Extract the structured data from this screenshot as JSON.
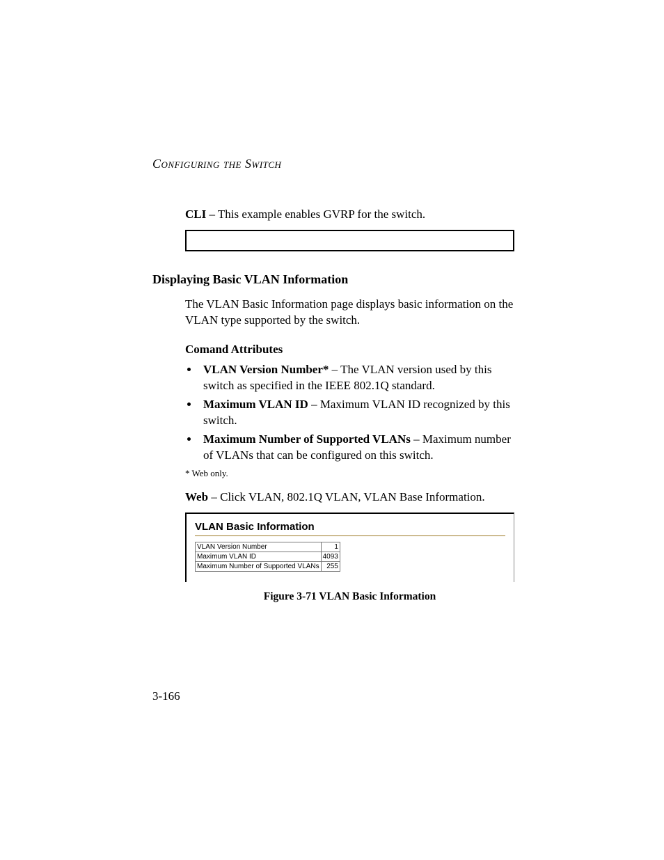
{
  "header": {
    "running_head": "Configuring the Switch"
  },
  "cli": {
    "label": "CLI",
    "text": " – This example enables GVRP for the switch."
  },
  "section": {
    "title": "Displaying Basic VLAN Information",
    "intro": "The VLAN Basic Information page displays basic information on the VLAN type supported by the switch."
  },
  "attributes": {
    "heading": "Comand Attributes",
    "items": [
      {
        "term": "VLAN Version Number*",
        "desc": " – The VLAN version used by this switch as specified in the IEEE 802.1Q standard."
      },
      {
        "term": "Maximum VLAN ID",
        "desc": " – Maximum VLAN ID recognized by this switch."
      },
      {
        "term": "Maximum Number of Supported VLANs",
        "desc": " – Maximum number of VLANs that can be configured on this switch."
      }
    ],
    "footnote": "* Web only."
  },
  "web": {
    "label": "Web",
    "text": " – Click VLAN, 802.1Q VLAN, VLAN Base Information."
  },
  "panel": {
    "title": "VLAN Basic Information",
    "rows": [
      {
        "label": "VLAN Version Number",
        "value": "1"
      },
      {
        "label": "Maximum VLAN ID",
        "value": "4093"
      },
      {
        "label": "Maximum Number of Supported VLANs",
        "value": "255"
      }
    ]
  },
  "figure": {
    "caption": "Figure 3-71  VLAN Basic Information"
  },
  "pagenum": "3-166"
}
